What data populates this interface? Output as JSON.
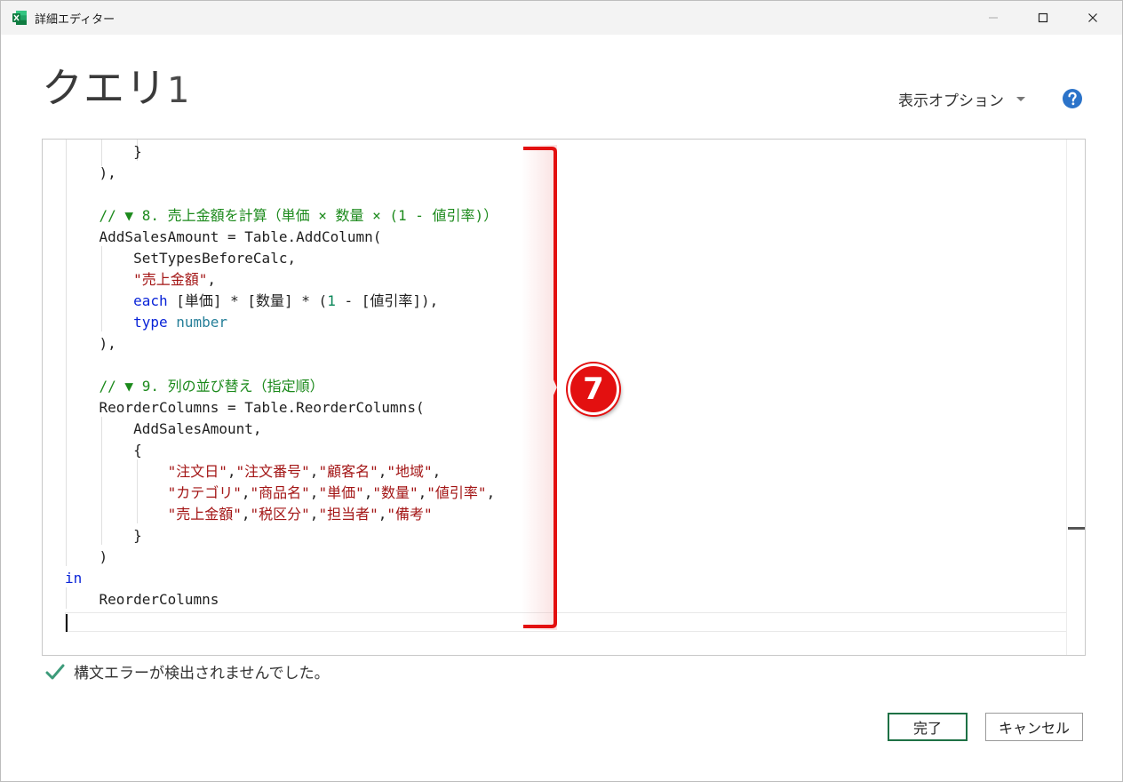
{
  "window": {
    "title": "詳細エディター",
    "app_icon": "excel-icon"
  },
  "header": {
    "query_title": "クエリ",
    "query_number": "1",
    "display_options_label": "表示オプション",
    "help_icon": "help-icon"
  },
  "editor": {
    "lines": [
      {
        "i": 2,
        "parts": [
          [
            "p",
            "}"
          ]
        ]
      },
      {
        "i": 1,
        "parts": [
          [
            "p",
            "),"
          ]
        ]
      },
      {
        "i": 0,
        "parts": []
      },
      {
        "i": 1,
        "parts": [
          [
            "cm",
            "// ▼ 8. 売上金額を計算（単価 × 数量 × (1 - 値引率)）"
          ]
        ]
      },
      {
        "i": 1,
        "parts": [
          [
            "p",
            "AddSalesAmount = Table.AddColumn("
          ]
        ]
      },
      {
        "i": 2,
        "parts": [
          [
            "p",
            "SetTypesBeforeCalc,"
          ]
        ]
      },
      {
        "i": 2,
        "parts": [
          [
            "str",
            "\"売上金額\""
          ],
          [
            "p",
            ","
          ]
        ]
      },
      {
        "i": 2,
        "parts": [
          [
            "kw",
            "each"
          ],
          [
            "p",
            " [単価] * [数量] * ("
          ],
          [
            "num",
            "1"
          ],
          [
            "p",
            " - [値引率]),"
          ]
        ]
      },
      {
        "i": 2,
        "parts": [
          [
            "kw",
            "type"
          ],
          [
            "p",
            " "
          ],
          [
            "tp",
            "number"
          ]
        ]
      },
      {
        "i": 1,
        "parts": [
          [
            "p",
            "),"
          ]
        ]
      },
      {
        "i": 0,
        "parts": []
      },
      {
        "i": 1,
        "parts": [
          [
            "cm",
            "// ▼ 9. 列の並び替え（指定順）"
          ]
        ]
      },
      {
        "i": 1,
        "parts": [
          [
            "p",
            "ReorderColumns = Table.ReorderColumns("
          ]
        ]
      },
      {
        "i": 2,
        "parts": [
          [
            "p",
            "AddSalesAmount,"
          ]
        ]
      },
      {
        "i": 2,
        "parts": [
          [
            "p",
            "{"
          ]
        ]
      },
      {
        "i": 3,
        "parts": [
          [
            "str",
            "\"注文日\""
          ],
          [
            "p",
            ","
          ],
          [
            "str",
            "\"注文番号\""
          ],
          [
            "p",
            ","
          ],
          [
            "str",
            "\"顧客名\""
          ],
          [
            "p",
            ","
          ],
          [
            "str",
            "\"地域\""
          ],
          [
            "p",
            ","
          ]
        ]
      },
      {
        "i": 3,
        "parts": [
          [
            "str",
            "\"カテゴリ\""
          ],
          [
            "p",
            ","
          ],
          [
            "str",
            "\"商品名\""
          ],
          [
            "p",
            ","
          ],
          [
            "str",
            "\"単価\""
          ],
          [
            "p",
            ","
          ],
          [
            "str",
            "\"数量\""
          ],
          [
            "p",
            ","
          ],
          [
            "str",
            "\"値引率\""
          ],
          [
            "p",
            ","
          ]
        ]
      },
      {
        "i": 3,
        "parts": [
          [
            "str",
            "\"売上金額\""
          ],
          [
            "p",
            ","
          ],
          [
            "str",
            "\"税区分\""
          ],
          [
            "p",
            ","
          ],
          [
            "str",
            "\"担当者\""
          ],
          [
            "p",
            ","
          ],
          [
            "str",
            "\"備考\""
          ]
        ]
      },
      {
        "i": 2,
        "parts": [
          [
            "p",
            "}"
          ]
        ]
      },
      {
        "i": 1,
        "parts": [
          [
            "p",
            ")"
          ]
        ]
      },
      {
        "i": 0,
        "parts": [
          [
            "kw",
            "in"
          ]
        ]
      },
      {
        "i": 1,
        "parts": [
          [
            "p",
            "ReorderColumns"
          ]
        ]
      },
      {
        "i": 0,
        "parts": []
      }
    ]
  },
  "annotation": {
    "marker_label": "7",
    "color": "#e31010"
  },
  "status": {
    "message": "構文エラーが検出されませんでした。",
    "icon": "checkmark-icon"
  },
  "buttons": {
    "ok_label": "完了",
    "cancel_label": "キャンセル"
  },
  "colors": {
    "keyword": "#0a24d8",
    "string": "#a31515",
    "comment": "#1c8a1c",
    "number": "#098658",
    "type": "#267f99",
    "ok_border": "#1e7145"
  }
}
